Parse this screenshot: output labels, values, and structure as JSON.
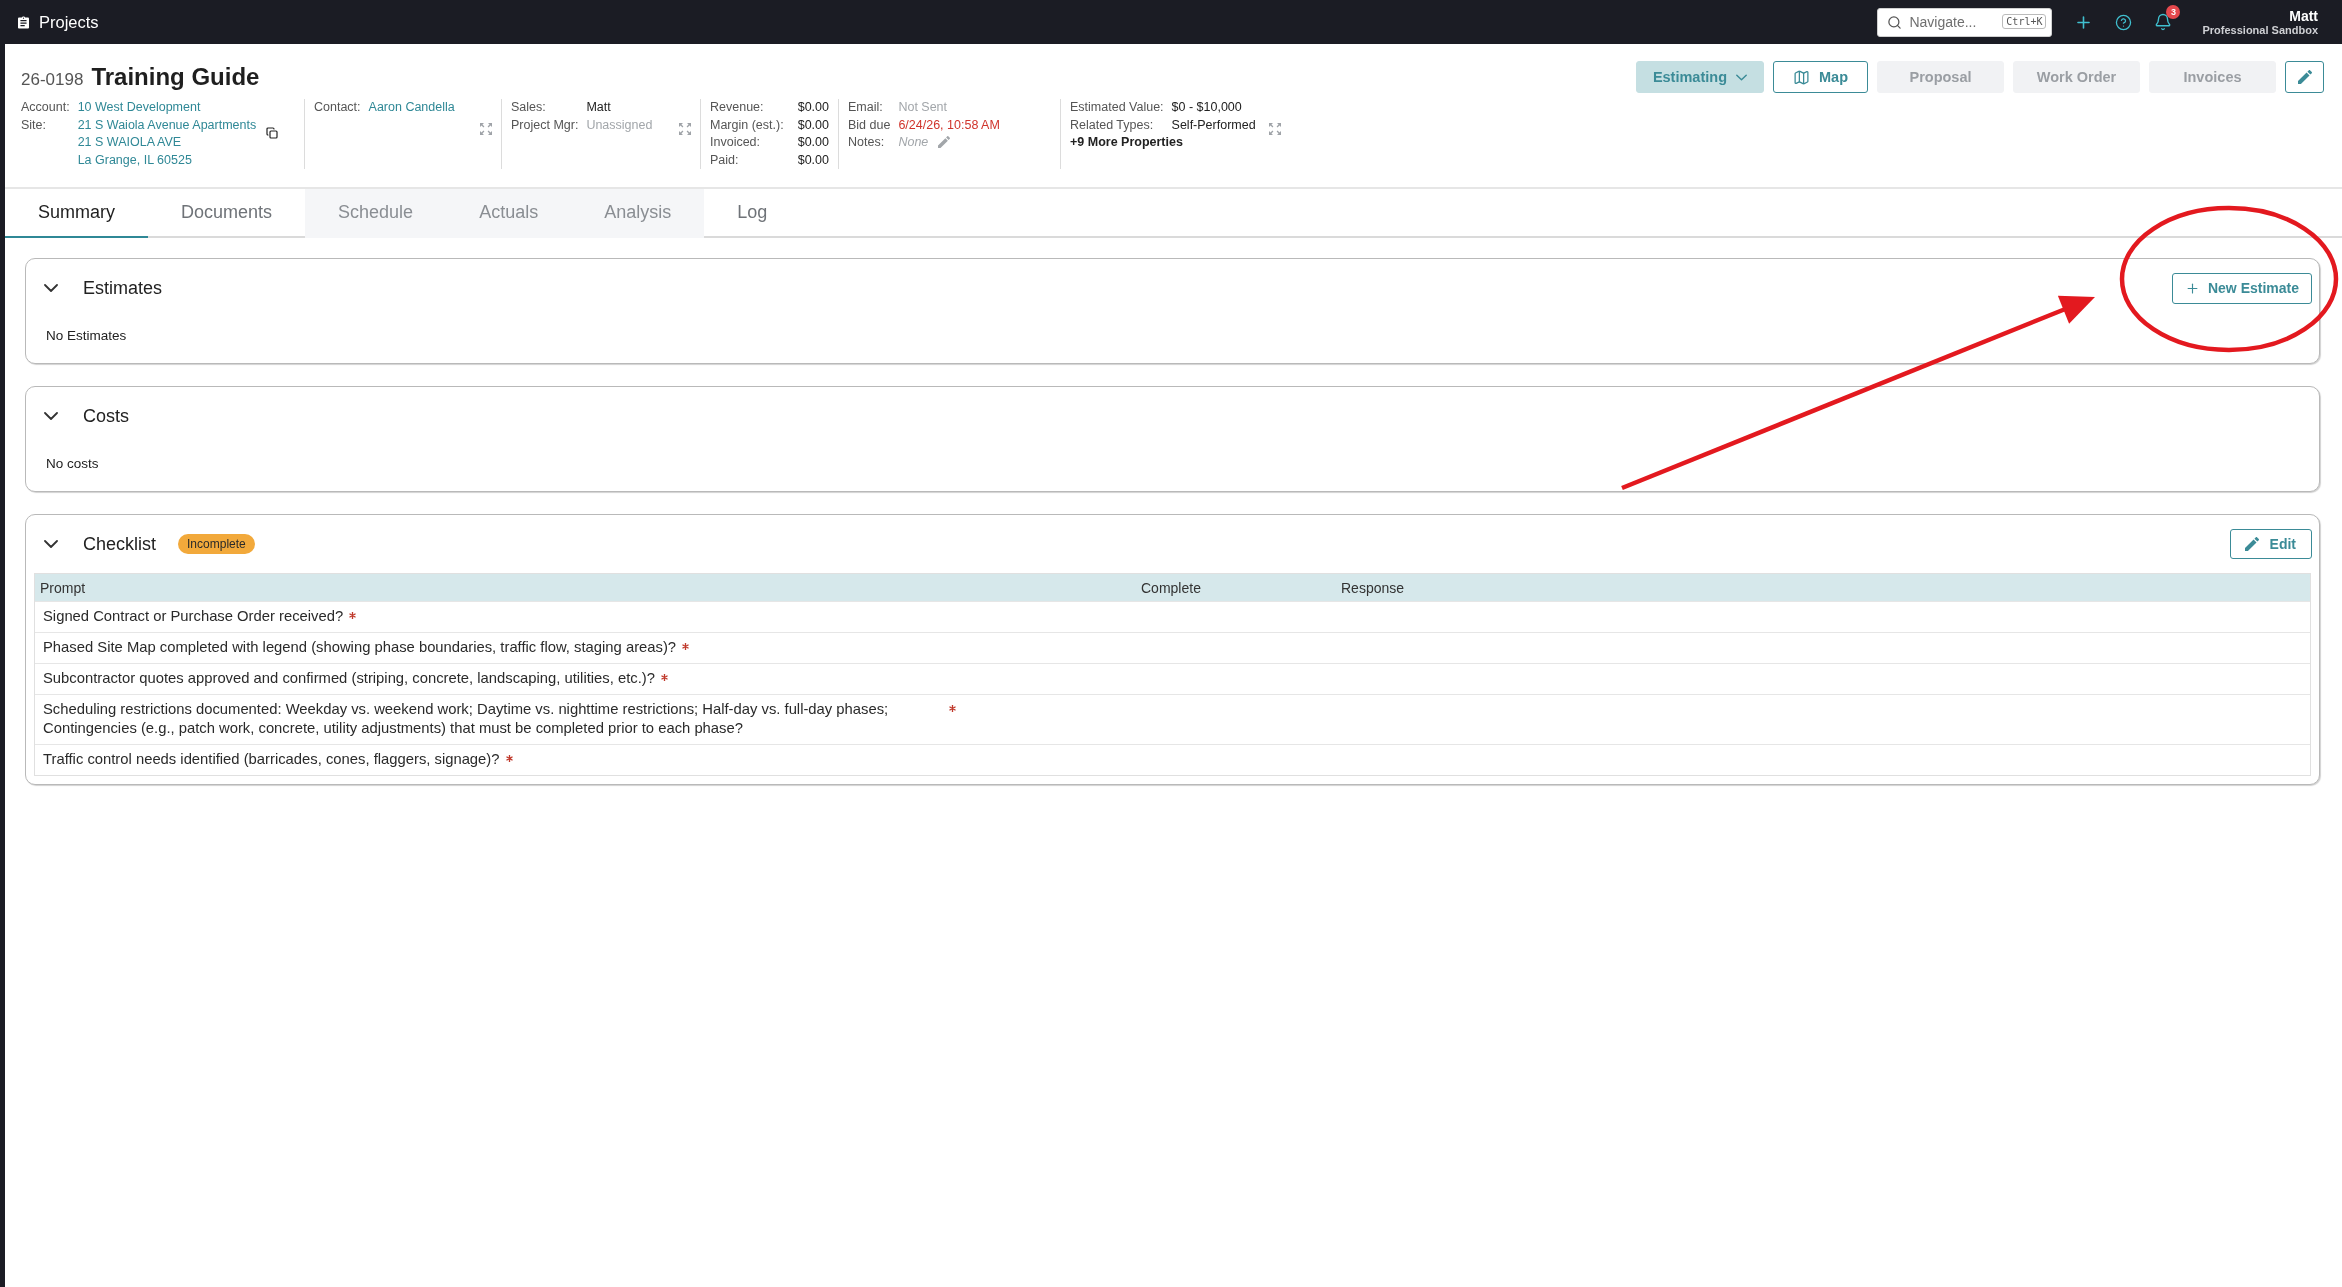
{
  "top_bar": {
    "title": "Projects",
    "search": {
      "placeholder": "Navigate...",
      "shortcut": "Ctrl+K"
    },
    "notifications": {
      "count": "3"
    },
    "user": {
      "name": "Matt",
      "workspace": "Professional Sandbox"
    }
  },
  "project": {
    "number": "26-0198",
    "title": "Training Guide"
  },
  "actions": [
    {
      "kind": "dropdown",
      "label": "Estimating",
      "disabled": false
    },
    {
      "kind": "map",
      "label": "Map",
      "disabled": false
    },
    {
      "kind": "plain",
      "label": "Proposal",
      "disabled": true
    },
    {
      "kind": "plain",
      "label": "Work Order",
      "disabled": true
    },
    {
      "kind": "plain",
      "label": "Invoices",
      "disabled": true
    },
    {
      "kind": "edit",
      "disabled": false
    }
  ],
  "details": [
    {
      "fields": [
        {
          "label": "Account:",
          "kind": "link",
          "lines": [
            "10 West Development"
          ]
        },
        {
          "label": "Site:",
          "kind": "link",
          "lines": [
            "21 S Waiola Avenue Apartments",
            "21 S WAIOLA AVE",
            "La Grange, IL 60525"
          ],
          "copyable": true
        }
      ]
    },
    {
      "fields": [
        {
          "label": "Contact:",
          "kind": "link",
          "lines": [
            "Aaron Candella"
          ]
        }
      ],
      "expandable": true
    },
    {
      "fields": [
        {
          "label": "Sales:",
          "kind": "text",
          "lines": [
            "Matt"
          ]
        },
        {
          "label": "Project Mgr:",
          "kind": "muted",
          "lines": [
            "Unassigned"
          ]
        }
      ],
      "expandable": true
    },
    {
      "fields": [
        {
          "label": "Revenue:",
          "kind": "amount",
          "lines": [
            "$0.00"
          ]
        },
        {
          "label": "Margin (est.):",
          "kind": "amount",
          "lines": [
            "$0.00"
          ]
        },
        {
          "label": "Invoiced:",
          "kind": "amount",
          "lines": [
            "$0.00"
          ]
        },
        {
          "label": "Paid:",
          "kind": "amount",
          "lines": [
            "$0.00"
          ]
        }
      ]
    },
    {
      "fields": [
        {
          "label": "Email:",
          "kind": "muted",
          "lines": [
            "Not Sent"
          ]
        },
        {
          "label": "Bid due",
          "kind": "alert",
          "lines": [
            "6/24/26, 10:58 AM"
          ]
        },
        {
          "label": "Notes:",
          "kind": "empty",
          "lines": [
            "None"
          ],
          "editable": true
        }
      ]
    },
    {
      "fields": [
        {
          "label": "Estimated Value:",
          "kind": "text",
          "lines": [
            "$0 - $10,000"
          ]
        },
        {
          "label": "Related Types:",
          "kind": "text",
          "lines": [
            "Self-Performed"
          ]
        }
      ],
      "more": "+9 More Properties",
      "expandable": true
    }
  ],
  "tabs": [
    {
      "label": "Summary",
      "selected": true,
      "disabled": false
    },
    {
      "label": "Documents",
      "selected": false,
      "disabled": false
    },
    {
      "label": "Schedule",
      "selected": false,
      "disabled": true
    },
    {
      "label": "Actuals",
      "selected": false,
      "disabled": true
    },
    {
      "label": "Analysis",
      "selected": false,
      "disabled": true
    },
    {
      "label": "Log",
      "selected": false,
      "disabled": false
    }
  ],
  "sections": [
    {
      "kind": "list",
      "title": "Estimates",
      "expanded": true,
      "empty_text": "No Estimates",
      "action": {
        "kind": "add",
        "label": "New Estimate"
      }
    },
    {
      "kind": "list",
      "title": "Costs",
      "expanded": true,
      "empty_text": "No costs"
    },
    {
      "kind": "checklist",
      "title": "Checklist",
      "expanded": true,
      "status": {
        "kind": "incomplete",
        "label": "Incomplete"
      },
      "action": {
        "kind": "edit",
        "label": "Edit"
      },
      "columns": [
        "Prompt",
        "Complete",
        "Response"
      ],
      "rows": [
        {
          "prompt": "Signed Contract or Purchase Order received?",
          "required": true
        },
        {
          "prompt": "Phased Site Map completed with legend (showing phase boundaries, traffic flow, staging areas)?",
          "required": true
        },
        {
          "prompt": "Subcontractor quotes approved and confirmed (striping, concrete, landscaping, utilities, etc.)?",
          "required": true
        },
        {
          "prompt": "Scheduling restrictions documented: Weekday vs. weekend work; Daytime vs. nighttime restrictions; Half-day vs. full-day phases; Contingencies (e.g., patch work, concrete, utility adjustments) that must be completed prior to each phase?",
          "required": true
        },
        {
          "prompt": "Traffic control needs identified (barricades, cones, flaggers, signage)?",
          "required": true
        }
      ]
    }
  ],
  "annotations": [
    {
      "kind": "ellipse"
    },
    {
      "kind": "arrow"
    }
  ]
}
